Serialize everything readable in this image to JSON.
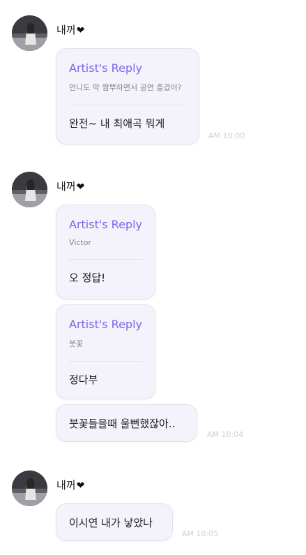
{
  "messages": [
    {
      "sender": "내꺼",
      "bubbles": [
        {
          "reply_label": "Artist's Reply",
          "quote": "언니도 막 짬뿌하면서 공연 즐겼어?",
          "text": "완전~ 내 최애곡 뭐게"
        }
      ],
      "time": "AM 10:00"
    },
    {
      "sender": "내꺼",
      "bubbles": [
        {
          "reply_label": "Artist's Reply",
          "quote": "Victor",
          "text": "오 정답!"
        },
        {
          "reply_label": "Artist's Reply",
          "quote": "붓꽃",
          "text": "정다부"
        },
        {
          "text": "붓꽃들을때 울뻔했잖아.."
        }
      ],
      "time": "AM 10:04"
    },
    {
      "sender": "내꺼",
      "bubbles": [
        {
          "text": "이시연 내가 낳았나"
        }
      ],
      "time": "AM 10:05"
    }
  ],
  "heart_glyph": "❤",
  "colors": {
    "reply_label": "#7d63e8",
    "bubble_bg": "#f4f3fb",
    "time": "#cfcfd6",
    "avatar_bg": "#2e2e33"
  },
  "icons": {
    "avatar": "user-photo",
    "heart": "heart-icon"
  }
}
